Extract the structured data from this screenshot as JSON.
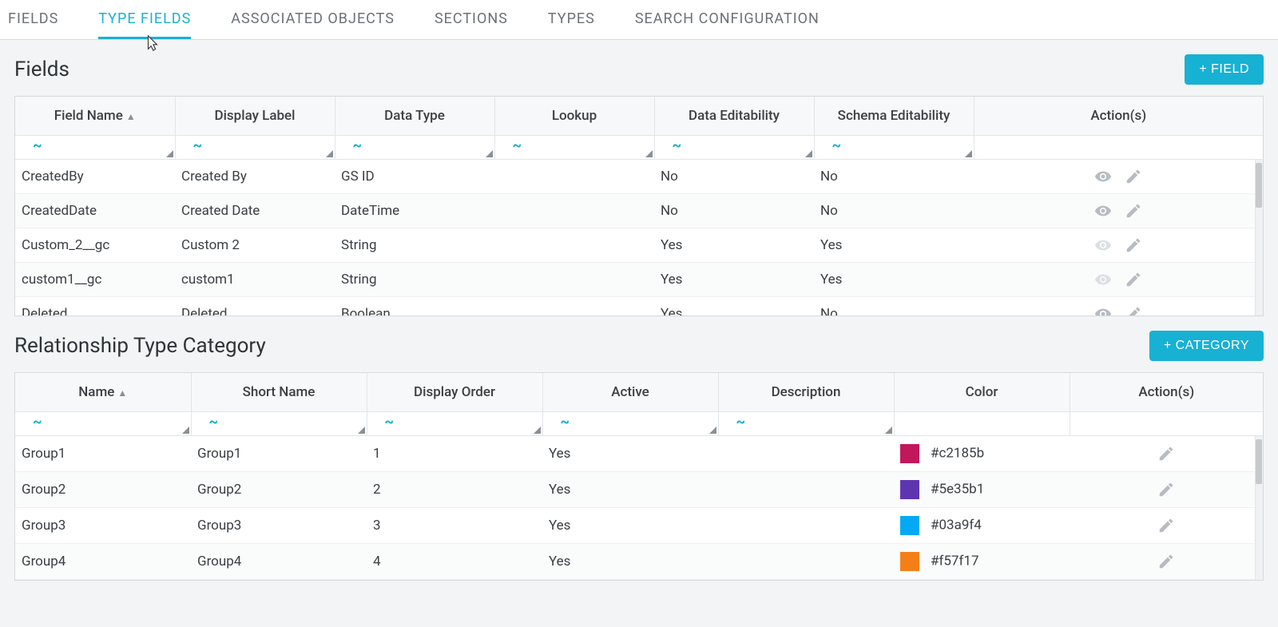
{
  "tabs": [
    {
      "label": "FIELDS",
      "active": false
    },
    {
      "label": "TYPE FIELDS",
      "active": true
    },
    {
      "label": "ASSOCIATED OBJECTS",
      "active": false
    },
    {
      "label": "SECTIONS",
      "active": false
    },
    {
      "label": "TYPES",
      "active": false
    },
    {
      "label": "SEARCH CONFIGURATION",
      "active": false
    }
  ],
  "fields_section": {
    "title": "Fields",
    "add_button": "+ FIELD",
    "columns": [
      "Field Name",
      "Display Label",
      "Data Type",
      "Lookup",
      "Data Editability",
      "Schema Editability",
      "Action(s)"
    ],
    "sort_column_index": 0,
    "rows": [
      {
        "field_name": "CreatedBy",
        "display_label": "Created By",
        "data_type": "GS ID",
        "lookup": "",
        "data_edit": "No",
        "schema_edit": "No",
        "view_dim": false
      },
      {
        "field_name": "CreatedDate",
        "display_label": "Created Date",
        "data_type": "DateTime",
        "lookup": "",
        "data_edit": "No",
        "schema_edit": "No",
        "view_dim": false
      },
      {
        "field_name": "Custom_2__gc",
        "display_label": "Custom 2",
        "data_type": "String",
        "lookup": "",
        "data_edit": "Yes",
        "schema_edit": "Yes",
        "view_dim": true
      },
      {
        "field_name": "custom1__gc",
        "display_label": "custom1",
        "data_type": "String",
        "lookup": "",
        "data_edit": "Yes",
        "schema_edit": "Yes",
        "view_dim": true
      },
      {
        "field_name": "Deleted",
        "display_label": "Deleted",
        "data_type": "Boolean",
        "lookup": "",
        "data_edit": "Yes",
        "schema_edit": "No",
        "view_dim": false
      }
    ]
  },
  "category_section": {
    "title": "Relationship Type Category",
    "add_button": "+ CATEGORY",
    "columns": [
      "Name",
      "Short Name",
      "Display Order",
      "Active",
      "Description",
      "Color",
      "Action(s)"
    ],
    "sort_column_index": 0,
    "rows": [
      {
        "name": "Group1",
        "short": "Group1",
        "order": "1",
        "active": "Yes",
        "desc": "",
        "color": "#c2185b"
      },
      {
        "name": "Group2",
        "short": "Group2",
        "order": "2",
        "active": "Yes",
        "desc": "",
        "color": "#5e35b1"
      },
      {
        "name": "Group3",
        "short": "Group3",
        "order": "3",
        "active": "Yes",
        "desc": "",
        "color": "#03a9f4"
      },
      {
        "name": "Group4",
        "short": "Group4",
        "order": "4",
        "active": "Yes",
        "desc": "",
        "color": "#f57f17"
      }
    ]
  },
  "filter_marker": "~",
  "colors": {
    "accent": "#17b1d4"
  }
}
